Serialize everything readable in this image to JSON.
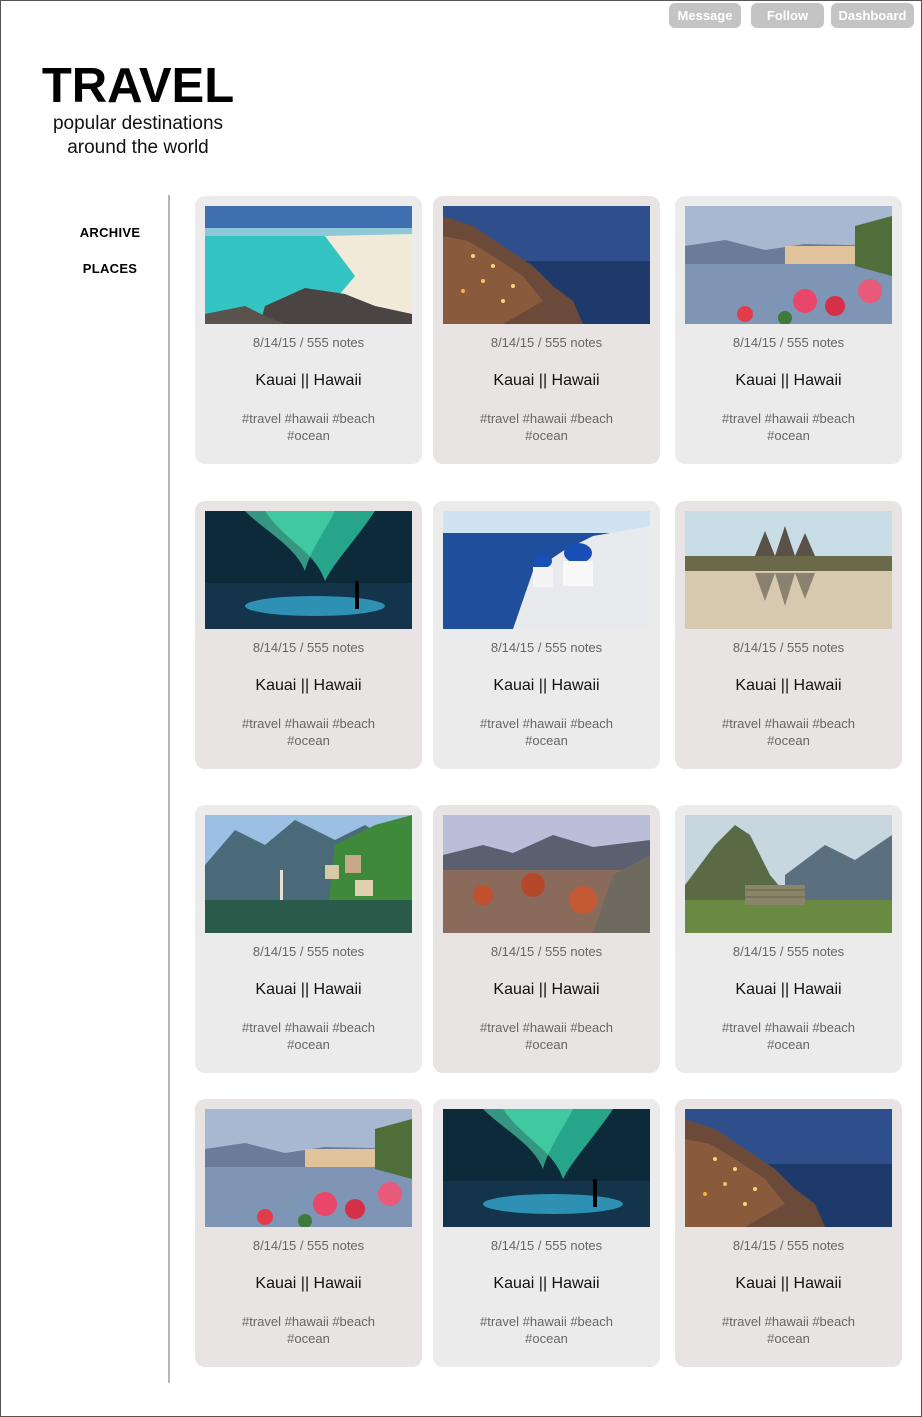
{
  "header": {
    "buttons": {
      "message": "Message",
      "follow": "Follow",
      "dashboard": "Dashboard"
    },
    "title": "TRAVEL",
    "subtitle_line1": "popular destinations",
    "subtitle_line2": "around the world"
  },
  "sidebar": {
    "items": [
      {
        "label": "ARCHIVE"
      },
      {
        "label": "PLACES"
      }
    ]
  },
  "posts": [
    {
      "meta": "8/14/15 / 555 notes",
      "title": "Kauai || Hawaii",
      "tags_line1": "#travel #hawaii #beach",
      "tags_line2": "#ocean",
      "image": "beach"
    },
    {
      "meta": "8/14/15 / 555 notes",
      "title": "Kauai || Hawaii",
      "tags_line1": "#travel #hawaii #beach",
      "tags_line2": "#ocean",
      "image": "cliff-village-night"
    },
    {
      "meta": "8/14/15 / 555 notes",
      "title": "Kauai || Hawaii",
      "tags_line1": "#travel #hawaii #beach",
      "tags_line2": "#ocean",
      "image": "lake-flowers"
    },
    {
      "meta": "8/14/15 / 555 notes",
      "title": "Kauai || Hawaii",
      "tags_line1": "#travel #hawaii #beach",
      "tags_line2": "#ocean",
      "image": "aurora"
    },
    {
      "meta": "8/14/15 / 555 notes",
      "title": "Kauai || Hawaii",
      "tags_line1": "#travel #hawaii #beach",
      "tags_line2": "#ocean",
      "image": "santorini"
    },
    {
      "meta": "8/14/15 / 555 notes",
      "title": "Kauai || Hawaii",
      "tags_line1": "#travel #hawaii #beach",
      "tags_line2": "#ocean",
      "image": "temple-reflection"
    },
    {
      "meta": "8/14/15 / 555 notes",
      "title": "Kauai || Hawaii",
      "tags_line1": "#travel #hawaii #beach",
      "tags_line2": "#ocean",
      "image": "alpine-village"
    },
    {
      "meta": "8/14/15 / 555 notes",
      "title": "Kauai || Hawaii",
      "tags_line1": "#travel #hawaii #beach",
      "tags_line2": "#ocean",
      "image": "coastal-town-dusk"
    },
    {
      "meta": "8/14/15 / 555 notes",
      "title": "Kauai || Hawaii",
      "tags_line1": "#travel #hawaii #beach",
      "tags_line2": "#ocean",
      "image": "mountain-ruins"
    },
    {
      "meta": "8/14/15 / 555 notes",
      "title": "Kauai || Hawaii",
      "tags_line1": "#travel #hawaii #beach",
      "tags_line2": "#ocean",
      "image": "lake-flowers"
    },
    {
      "meta": "8/14/15 / 555 notes",
      "title": "Kauai || Hawaii",
      "tags_line1": "#travel #hawaii #beach",
      "tags_line2": "#ocean",
      "image": "aurora"
    },
    {
      "meta": "8/14/15 / 555 notes",
      "title": "Kauai || Hawaii",
      "tags_line1": "#travel #hawaii #beach",
      "tags_line2": "#ocean",
      "image": "cliff-village-night"
    }
  ],
  "colors": {
    "button_bg": "#c4c4c4",
    "card_light": "#ebebeb",
    "card_warm": "#e9e4e4",
    "divider": "#b5b5b5"
  }
}
